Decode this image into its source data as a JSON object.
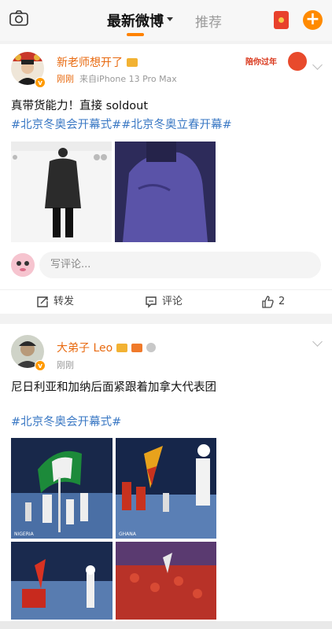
{
  "header": {
    "tab_active": "最新微博",
    "tab_other": "推荐",
    "accent": "#ff8200"
  },
  "post1": {
    "author": "新老师想开了",
    "time": "刚刚",
    "source": "来自iPhone 13 Pro Max",
    "badge_text": "陪你过年",
    "text": "真带货能力！直接 soldout",
    "hashtags": "#北京冬奥会开幕式##北京冬奥立春开幕#",
    "comment_placeholder": "写评论...",
    "repost_label": "转发",
    "comment_label": "评论",
    "like_count": "2"
  },
  "post2": {
    "author": "大弟子 Leo",
    "time": "刚刚",
    "text": "尼日利亚和加纳后面紧跟着加拿大代表团",
    "hashtags": "#北京冬奥会开幕式#",
    "image_captions": [
      "NIGERIA",
      "GHANA"
    ]
  }
}
